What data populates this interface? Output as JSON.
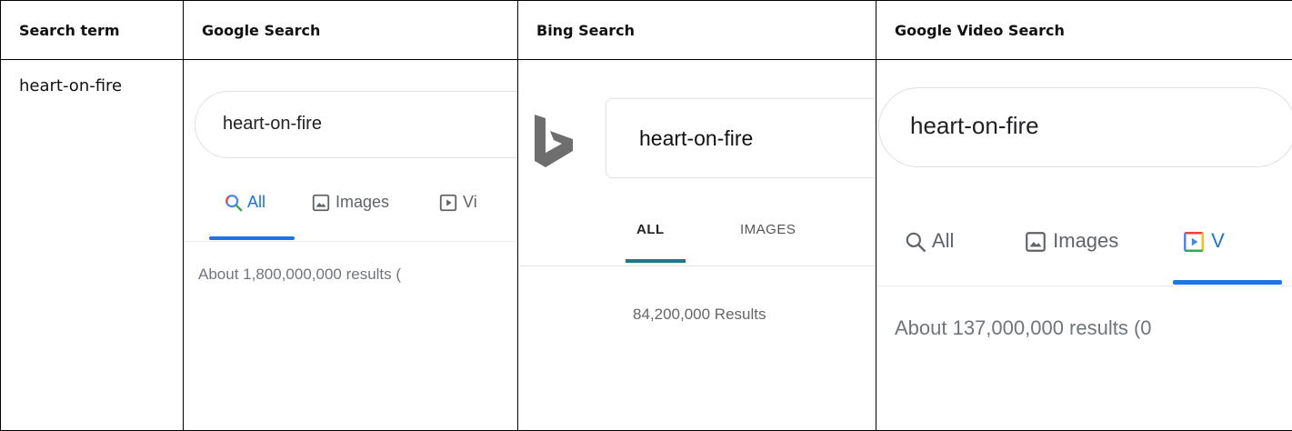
{
  "table": {
    "headers": [
      "Search term",
      "Google Search",
      "Bing Search",
      "Google Video Search"
    ],
    "term": "heart-on-fire"
  },
  "google": {
    "query": "heart-on-fire",
    "tabs": {
      "all": "All",
      "images": "Images",
      "videos": "Vi"
    },
    "results": "About 1,800,000,000 results (",
    "accent_color": "#1a73e8"
  },
  "bing": {
    "query": "heart-on-fire",
    "tabs": {
      "all": "ALL",
      "images": "IMAGES"
    },
    "results": "84,200,000 Results",
    "logo_icon": "bing-logo-icon",
    "accent_color": "#1a7a8a"
  },
  "google_video": {
    "query": "heart-on-fire",
    "tabs": {
      "all": "All",
      "images": "Images",
      "videos": "V"
    },
    "results": "About 137,000,000 results (0",
    "accent_color": "#1a73e8"
  }
}
